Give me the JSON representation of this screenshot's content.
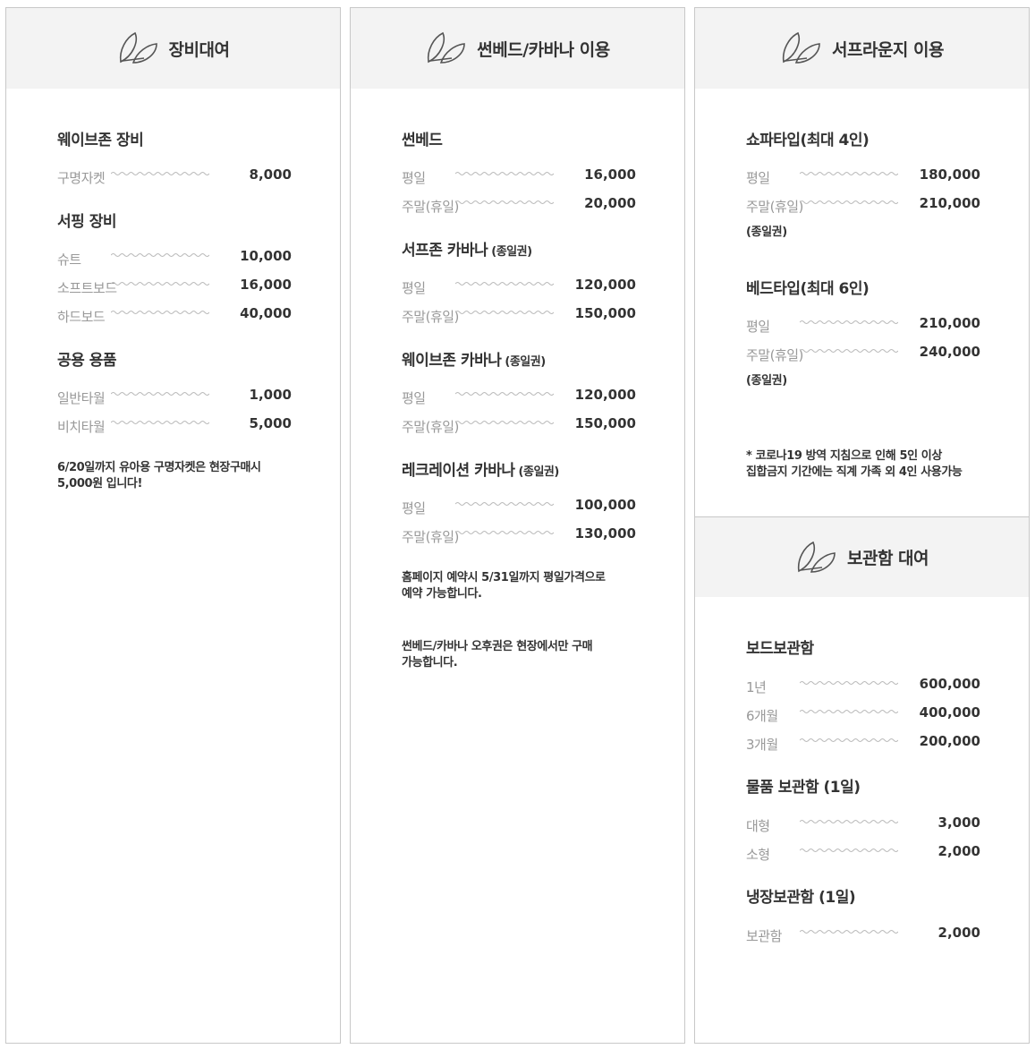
{
  "rental": {
    "title": "장비대여",
    "sections": [
      {
        "title": "웨이브존 장비",
        "rows": [
          {
            "label": "구명자켓",
            "price": "8,000"
          }
        ]
      },
      {
        "title": "서핑 장비",
        "rows": [
          {
            "label": "슈트",
            "price": "10,000"
          },
          {
            "label": "소프트보드",
            "price": "16,000"
          },
          {
            "label": "하드보드",
            "price": "40,000"
          }
        ]
      },
      {
        "title": "공용 용품",
        "rows": [
          {
            "label": "일반타월",
            "price": "1,000"
          },
          {
            "label": "비치타월",
            "price": "5,000"
          }
        ]
      }
    ],
    "note_line1": "6/20일까지 유아용 구명자켓은 현장구매시",
    "note_line2": "5,000원 입니다!"
  },
  "sunbed": {
    "title": "썬베드/카바나 이용",
    "sections": [
      {
        "title": "썬베드",
        "sub": "",
        "rows": [
          {
            "label": "평일",
            "price": "16,000"
          },
          {
            "label": "주말(휴일)",
            "price": "20,000"
          }
        ]
      },
      {
        "title": "서프존 카바나",
        "sub": "(종일권)",
        "rows": [
          {
            "label": "평일",
            "price": "120,000"
          },
          {
            "label": "주말(휴일)",
            "price": "150,000"
          }
        ]
      },
      {
        "title": "웨이브존 카바나",
        "sub": "(종일권)",
        "rows": [
          {
            "label": "평일",
            "price": "120,000"
          },
          {
            "label": "주말(휴일)",
            "price": "150,000"
          }
        ]
      },
      {
        "title": "레크레이션 카바나",
        "sub": "(종일권)",
        "rows": [
          {
            "label": "평일",
            "price": "100,000"
          },
          {
            "label": "주말(휴일)",
            "price": "130,000"
          }
        ]
      }
    ],
    "note1_line1": "홈페이지 예약시 5/31일까지 평일가격으로",
    "note1_line2": "예약 가능합니다.",
    "note2_line1": "썬베드/카바나 오후권은 현장에서만 구매",
    "note2_line2": "가능합니다."
  },
  "lounge": {
    "title": "서프라운지 이용",
    "sections": [
      {
        "title": "쇼파타입(최대 4인)",
        "rows": [
          {
            "label": "평일",
            "price": "180,000"
          },
          {
            "label": "주말(휴일)",
            "price": "210,000"
          }
        ],
        "tag": "(종일권)"
      },
      {
        "title": "베드타입(최대 6인)",
        "rows": [
          {
            "label": "평일",
            "price": "210,000"
          },
          {
            "label": "주말(휴일)",
            "price": "240,000"
          }
        ],
        "tag": "(종일권)"
      }
    ],
    "note_line1": "* 코로나19 방역 지침으로 인해 5인 이상",
    "note_line2": "집합금지 기간에는 직계 가족 외 4인 사용가능"
  },
  "locker": {
    "title": "보관함 대여",
    "sections": [
      {
        "title": "보드보관함",
        "rows": [
          {
            "label": "1년",
            "price": "600,000"
          },
          {
            "label": "6개월",
            "price": "400,000"
          },
          {
            "label": "3개월",
            "price": "200,000"
          }
        ]
      },
      {
        "title": "물품 보관함 (1일)",
        "rows": [
          {
            "label": "대형",
            "price": "3,000"
          },
          {
            "label": "소형",
            "price": "2,000"
          }
        ]
      },
      {
        "title": "냉장보관함 (1일)",
        "rows": [
          {
            "label": "보관함",
            "price": "2,000"
          }
        ]
      }
    ]
  },
  "icons": {
    "header_icon": "leaf-icon",
    "dotted_line": "wave-line"
  },
  "colors": {
    "header_bg": "#f3f3f3",
    "border": "#c8c8c8",
    "label": "#999999",
    "text": "#333333"
  }
}
